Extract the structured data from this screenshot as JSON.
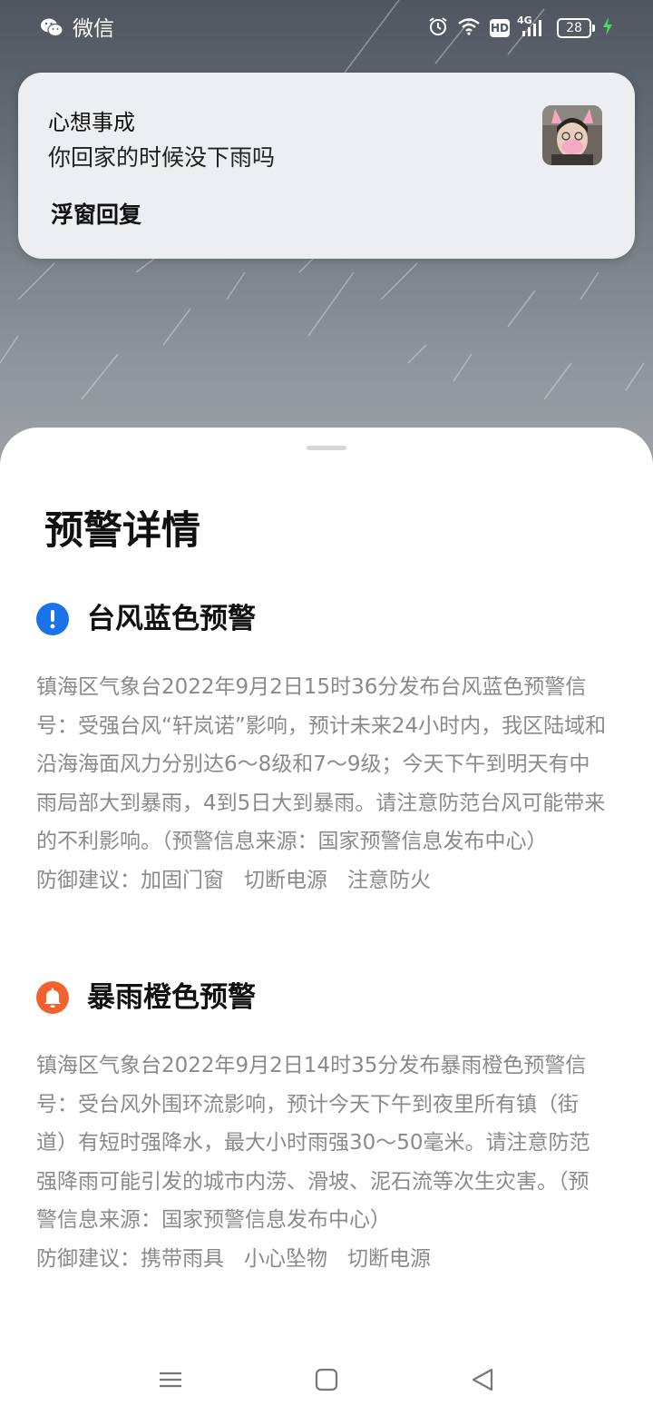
{
  "status_bar": {
    "app_name": "微信",
    "app_icon": "wechat-icon",
    "battery_level": "28",
    "network_badge": "HD",
    "network_type": "4G",
    "icons": [
      "alarm-icon",
      "wifi-icon",
      "hd-icon",
      "signal-icon",
      "battery-icon",
      "charging-icon"
    ]
  },
  "notification": {
    "title": "心想事成",
    "message": "你回家的时候没下雨吗",
    "action_label": "浮窗回复",
    "avatar_icon": "avatar"
  },
  "sheet": {
    "title": "预警详情",
    "alerts": [
      {
        "title": "台风蓝色预警",
        "icon": "exclamation-icon",
        "color": "#1a73e8",
        "description": "镇海区气象台2022年9月2日15时36分发布台风蓝色预警信号：受强台风“轩岚诺”影响，预计未来24小时内，我区陆域和沿海海面风力分别达6～8级和7～9级；今天下午到明天有中雨局部大到暴雨，4到5日大到暴雨。请注意防范台风可能带来的不利影响。（预警信息来源：国家预警信息发布中心）",
        "advice_label": "防御建议：",
        "advice": [
          "加固门窗",
          "切断电源",
          "注意防火"
        ]
      },
      {
        "title": "暴雨橙色预警",
        "icon": "bell-icon",
        "color": "#f2622e",
        "description": "镇海区气象台2022年9月2日14时35分发布暴雨橙色预警信号：受台风外围环流影响，预计今天下午到夜里所有镇（街道）有短时强降水，最大小时雨强30～50毫米。请注意防范强降雨可能引发的城市内涝、滑坡、泥石流等次生灾害。（预警信息来源：国家预警信息发布中心）",
        "advice_label": "防御建议：",
        "advice": [
          "携带雨具",
          "小心坠物",
          "切断电源"
        ]
      }
    ]
  },
  "nav_bar": {
    "items": [
      "menu-icon",
      "home-icon",
      "back-icon"
    ]
  }
}
